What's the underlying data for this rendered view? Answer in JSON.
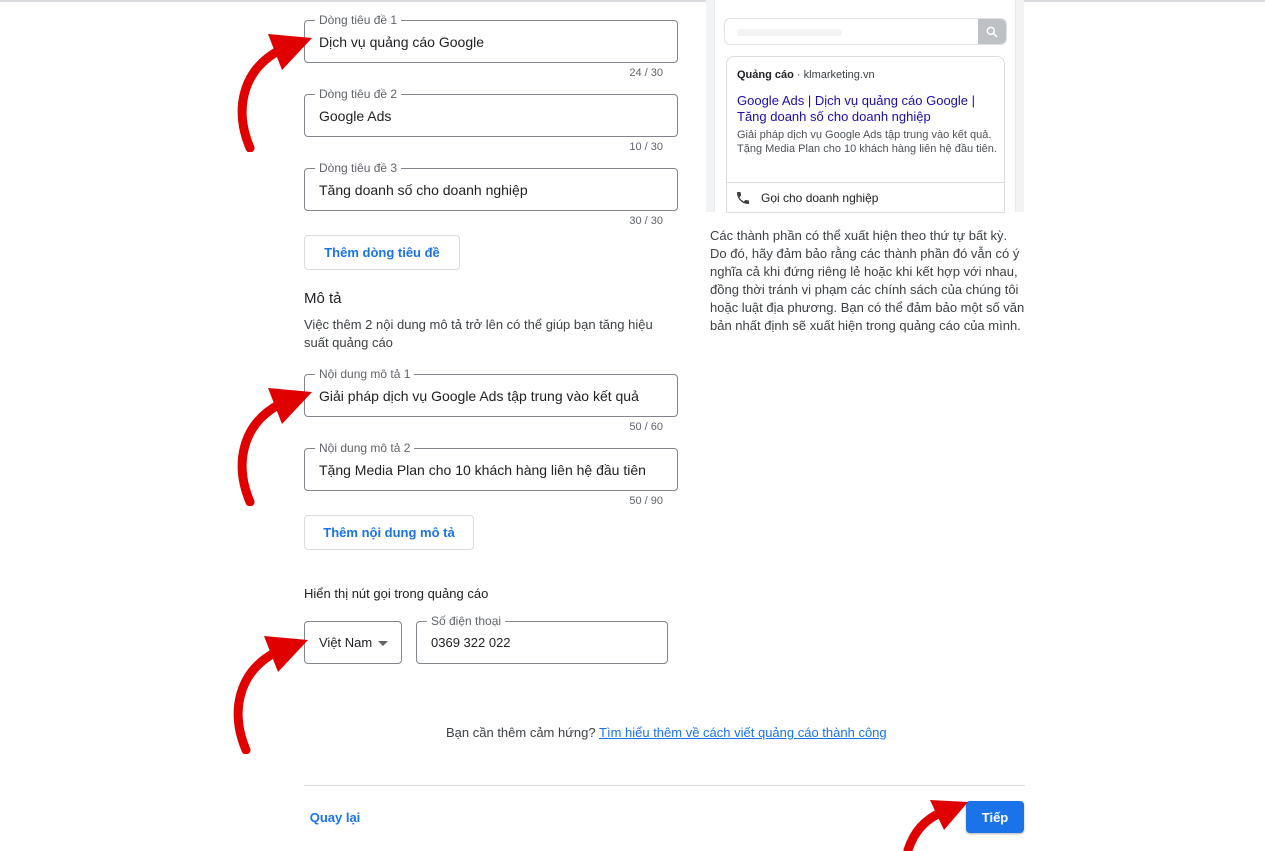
{
  "headlines": [
    {
      "label": "Dòng tiêu đề 1",
      "value": "Dịch vụ quảng cáo Google",
      "counter": "24 / 30"
    },
    {
      "label": "Dòng tiêu đề 2",
      "value": "Google Ads",
      "counter": "10 / 30"
    },
    {
      "label": "Dòng tiêu đề 3",
      "value": "Tăng doanh số cho doanh nghiệp",
      "counter": "30 / 30"
    }
  ],
  "add_headline_label": "Thêm dòng tiêu đề",
  "description_section": {
    "title": "Mô tả",
    "help": "Việc thêm 2 nội dung mô tả trở lên có thể giúp bạn tăng hiệu suất quảng cáo",
    "fields": [
      {
        "label": "Nội dung mô tả 1",
        "value": "Giải pháp dịch vụ Google Ads tập trung vào kết quả",
        "counter": "50 / 60"
      },
      {
        "label": "Nội dung mô tả 2",
        "value": "Tặng Media Plan cho 10 khách hàng liên hệ đầu tiên",
        "counter": "50 / 90"
      }
    ],
    "add_label": "Thêm nội dung mô tả"
  },
  "call": {
    "title": "Hiển thị nút gọi trong quảng cáo",
    "country": "Việt Nam",
    "phone_label": "Số điện thoại",
    "phone_value": "0369 322 022"
  },
  "inspiration": {
    "text": "Bạn cần thêm cảm hứng?",
    "link": "Tìm hiểu thêm về cách viết quảng cáo thành công"
  },
  "footer": {
    "back_label": "Quay lại",
    "next_label": "Tiếp"
  },
  "preview": {
    "ad_badge": "Quảng cáo",
    "separator": "·",
    "domain": "klmarketing.vn",
    "headline": "Google Ads | Dịch vụ quảng cáo Google | Tăng doanh số cho doanh nghiệp",
    "description": "Giải pháp dịch vụ Google Ads tập trung vào kết quả. Tặng Media Plan cho 10 khách hàng liên hệ đầu tiên.",
    "call_label": "Gọi cho doanh nghiệp",
    "search_icon": "search-icon",
    "phone_icon": "phone-icon"
  },
  "preview_note": "Các thành phần có thể xuất hiện theo thứ tự bất kỳ. Do đó, hãy đảm bảo rằng các thành phần đó vẫn có ý nghĩa cả khi đứng riêng lẻ hoặc khi kết hợp với nhau, đồng thời tránh vi phạm các chính sách của chúng tôi hoặc luật địa phương. Bạn có thể đảm bảo một số văn bản nhất định sẽ xuất hiện trong quảng cáo của mình.",
  "colors": {
    "accent": "#1a73e8",
    "ad_headline": "#1a0dab",
    "annotation_arrow": "#e00000"
  }
}
